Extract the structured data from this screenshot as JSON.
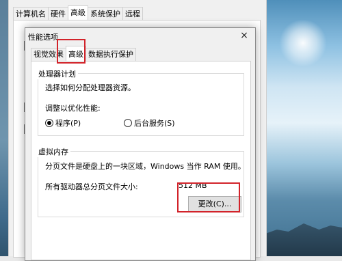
{
  "background_window": {
    "tabs": [
      "计算机名",
      "硬件",
      "高级",
      "系统保护",
      "远程"
    ],
    "active_tab_index": 2
  },
  "dialog": {
    "title": "性能选项",
    "close_glyph": "×",
    "tabs": [
      "视觉效果",
      "高级",
      "数据执行保护"
    ],
    "active_tab_index": 1,
    "processor": {
      "group_label": "处理器计划",
      "description": "选择如何分配处理器资源。",
      "optimize_label": "调整以优化性能:",
      "option_programs": "程序(P)",
      "option_services": "后台服务(S)",
      "selected": "programs"
    },
    "virtual_memory": {
      "group_label": "虚拟内存",
      "description": "分页文件是硬盘上的一块区域，Windows 当作 RAM 使用。",
      "total_label": "所有驱动器总分页文件大小:",
      "total_value": "512 MB",
      "change_button": "更改(C)..."
    }
  },
  "colors": {
    "highlight": "#d2232a"
  }
}
